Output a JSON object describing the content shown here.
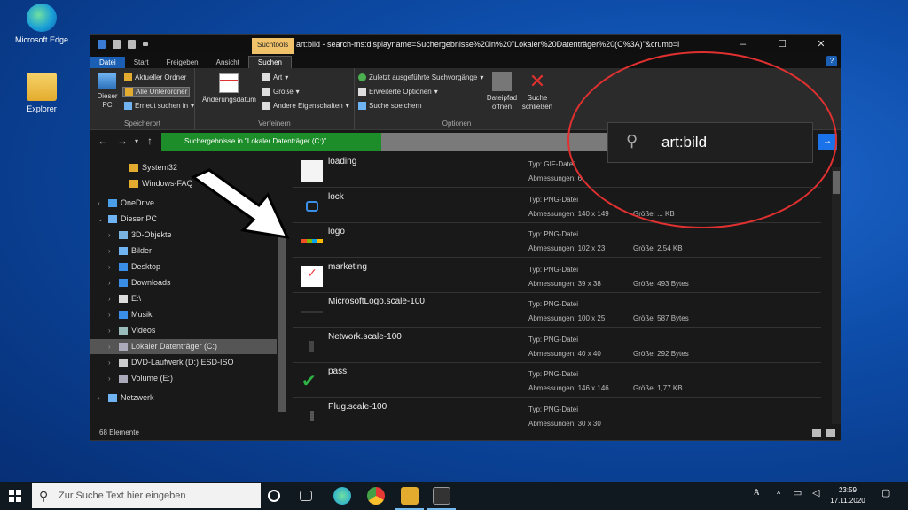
{
  "desktop": {
    "icons": [
      {
        "label": "Microsoft Edge",
        "icon": "edge-icon"
      },
      {
        "label": "Explorer",
        "icon": "folder-icon"
      }
    ]
  },
  "window": {
    "title": "art:bild - search-ms:displayname=Suchergebnisse%20in%20\"Lokaler%20Datenträger%20(C%3A)\"&crumb=l",
    "contextual_tab": "Suchtools",
    "tabs": [
      "Datei",
      "Start",
      "Freigeben",
      "Ansicht",
      "Suchen"
    ],
    "ribbon": {
      "speicherort": {
        "label": "Speicherort",
        "dieser_pc": "Dieser PC",
        "aktueller_ordner": "Aktueller Ordner",
        "alle_unterordner": "Alle Unterordner",
        "erneut_suchen": "Erneut suchen in"
      },
      "verfeinern": {
        "label": "Verfeinern",
        "aenderungsdatum": "Änderungsdatum",
        "art": "Art",
        "groesse": "Größe",
        "andere": "Andere Eigenschaften"
      },
      "optionen": {
        "label": "Optionen",
        "zuletzt": "Zuletzt ausgeführte Suchvorgänge",
        "erweitert": "Erweiterte Optionen",
        "speichern": "Suche speichern",
        "dateipfad": "Dateipfad öffnen",
        "schliessen": "Suche schließen"
      }
    },
    "address": "Suchergebnisse in \"Lokaler Datenträger (C:)\"",
    "search_query": "art:bild",
    "nav_items": [
      {
        "label": "System32",
        "indent": 2,
        "icon": "folder-icon",
        "chev": false
      },
      {
        "label": "Windows-FAQ",
        "indent": 2,
        "icon": "folder-icon",
        "chev": false
      },
      {
        "label": "OneDrive",
        "indent": 0,
        "icon": "onedrive-icon",
        "chev": true
      },
      {
        "label": "Dieser PC",
        "indent": 0,
        "icon": "pc-icon",
        "chev": true,
        "expanded": true
      },
      {
        "label": "3D-Objekte",
        "indent": 1,
        "icon": "objects3d-icon",
        "chev": true
      },
      {
        "label": "Bilder",
        "indent": 1,
        "icon": "pictures-icon",
        "chev": true
      },
      {
        "label": "Desktop",
        "indent": 1,
        "icon": "desktop-icon",
        "chev": true
      },
      {
        "label": "Downloads",
        "indent": 1,
        "icon": "downloads-icon",
        "chev": true
      },
      {
        "label": "E:\\",
        "indent": 1,
        "icon": "document-icon",
        "chev": true
      },
      {
        "label": "Musik",
        "indent": 1,
        "icon": "music-icon",
        "chev": true
      },
      {
        "label": "Videos",
        "indent": 1,
        "icon": "videos-icon",
        "chev": true
      },
      {
        "label": "Lokaler Datenträger (C:)",
        "indent": 1,
        "icon": "drive-icon",
        "chev": true,
        "selected": true
      },
      {
        "label": "DVD-Laufwerk (D:) ESD-ISO",
        "indent": 1,
        "icon": "dvd-icon",
        "chev": true
      },
      {
        "label": "Volume (E:)",
        "indent": 1,
        "icon": "drive-icon",
        "chev": true
      },
      {
        "label": "Netzwerk",
        "indent": 0,
        "icon": "network-icon",
        "chev": true
      }
    ],
    "files": [
      {
        "name": "loading",
        "type": "Typ: GIF-Datei",
        "dim": "Abmessungen: 6",
        "size": "",
        "thumb": "blank-thumb"
      },
      {
        "name": "lock",
        "type": "Typ: PNG-Datei",
        "dim": "Abmessungen: 140 x 149",
        "size": "Größe: ... KB",
        "thumb": "lock-thumb"
      },
      {
        "name": "logo",
        "type": "Typ: PNG-Datei",
        "dim": "Abmessungen: 102 x 23",
        "size": "Größe: 2,54 KB",
        "thumb": "logo-thumb"
      },
      {
        "name": "marketing",
        "type": "Typ: PNG-Datei",
        "dim": "Abmessungen: 39 x 38",
        "size": "Größe: 493 Bytes",
        "thumb": "marketing-thumb"
      },
      {
        "name": "MicrosoftLogo.scale-100",
        "type": "Typ: PNG-Datei",
        "dim": "Abmessungen: 100 x 25",
        "size": "Größe: 587 Bytes",
        "thumb": "mslogo-thumb"
      },
      {
        "name": "Network.scale-100",
        "type": "Typ: PNG-Datei",
        "dim": "Abmessungen: 40 x 40",
        "size": "Größe: 292 Bytes",
        "thumb": "network-thumb"
      },
      {
        "name": "pass",
        "type": "Typ: PNG-Datei",
        "dim": "Abmessungen: 146 x 146",
        "size": "Größe: 1,77 KB",
        "thumb": "check-thumb"
      },
      {
        "name": "Plug.scale-100",
        "type": "Typ: PNG-Datei",
        "dim": "Abmessungen: 30 x 30",
        "size": "",
        "thumb": "plug-thumb"
      }
    ],
    "status": "68 Elemente"
  },
  "taskbar": {
    "search_placeholder": "Zur Suche Text hier eingeben",
    "time": "23:59",
    "date": "17.11.2020"
  }
}
